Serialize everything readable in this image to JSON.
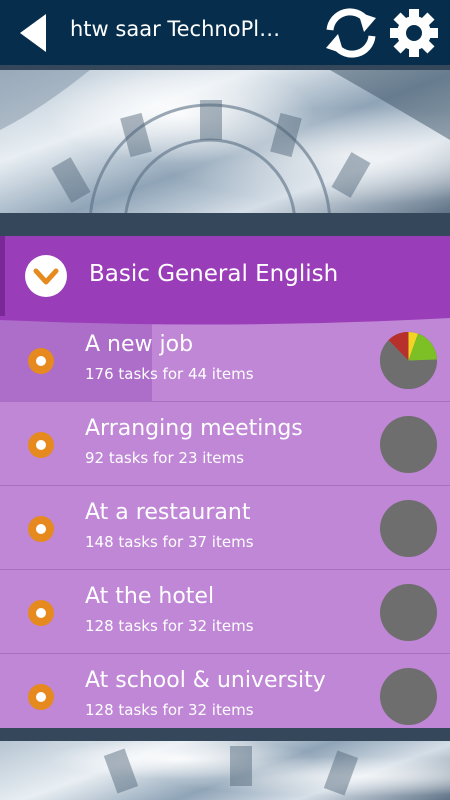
{
  "header": {
    "title": "htw saar TechnoPl…"
  },
  "course": {
    "title": "Basic General English"
  },
  "items": [
    {
      "title": "A new job",
      "subtitle": "176 tasks for 44 items"
    },
    {
      "title": "Arranging meetings",
      "subtitle": "92 tasks for 23 items"
    },
    {
      "title": "At a restaurant",
      "subtitle": "148 tasks for 37 items"
    },
    {
      "title": "At the hotel",
      "subtitle": "128 tasks for 32 items"
    },
    {
      "title": "At school & university",
      "subtitle": "128 tasks for 32 items"
    }
  ],
  "colors": {
    "header": "#062e4c",
    "course": "#9a3db8",
    "list": "#bf87d6",
    "bullet": "#e68a1f",
    "pie_gray": "#6e6e6e",
    "pie_red": "#b8302b",
    "pie_yellow": "#f3d424",
    "pie_green": "#7cc026"
  },
  "icons": {
    "back": "back-arrow-icon",
    "sync": "sync-icon",
    "settings": "gear-icon",
    "expand": "chevron-down-icon",
    "bullet": "bullet-dot-icon",
    "progress": "progress-pie-icon"
  }
}
